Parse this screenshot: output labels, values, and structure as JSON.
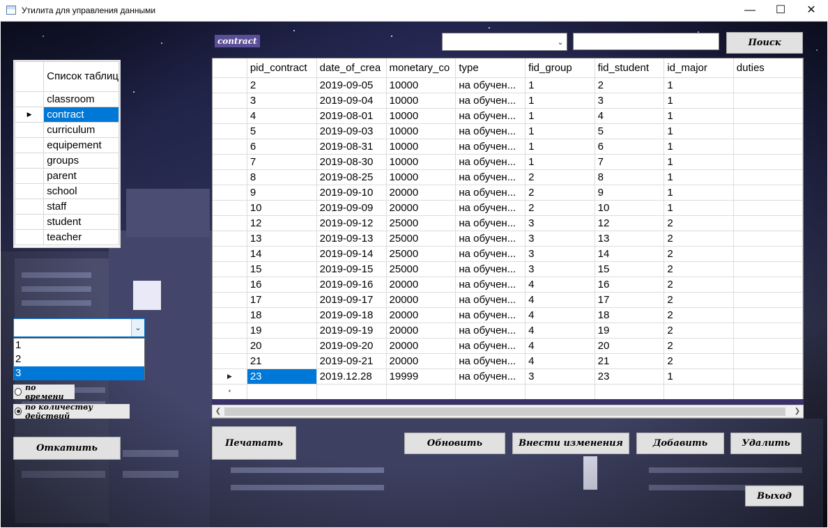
{
  "window": {
    "title": "Утилита для управления данными",
    "minimize_glyph": "—",
    "maximize_glyph": "☐",
    "close_glyph": "✕"
  },
  "current_table_tag": "contract",
  "search": {
    "field_combo_value": "",
    "query_value": "",
    "button_label": "Поиск"
  },
  "tables_list": {
    "header": "Список таблиц",
    "items": [
      "classroom",
      "contract",
      "curriculum",
      "equipement",
      "groups",
      "parent",
      "school",
      "staff",
      "student",
      "teacher"
    ],
    "selected": "contract"
  },
  "grid": {
    "columns": [
      "pid_contract",
      "date_of_crea",
      "monetary_co",
      "type",
      "fid_group",
      "fid_student",
      "id_major",
      "duties"
    ],
    "rows": [
      [
        "2",
        "2019-09-05",
        "10000",
        "на обучен...",
        "1",
        "2",
        "1",
        ""
      ],
      [
        "3",
        "2019-09-04",
        "10000",
        "на обучен...",
        "1",
        "3",
        "1",
        ""
      ],
      [
        "4",
        "2019-08-01",
        "10000",
        "на обучен...",
        "1",
        "4",
        "1",
        ""
      ],
      [
        "5",
        "2019-09-03",
        "10000",
        "на обучен...",
        "1",
        "5",
        "1",
        ""
      ],
      [
        "6",
        "2019-08-31",
        "10000",
        "на обучен...",
        "1",
        "6",
        "1",
        ""
      ],
      [
        "7",
        "2019-08-30",
        "10000",
        "на обучен...",
        "1",
        "7",
        "1",
        ""
      ],
      [
        "8",
        "2019-08-25",
        "10000",
        "на обучен...",
        "2",
        "8",
        "1",
        ""
      ],
      [
        "9",
        "2019-09-10",
        "20000",
        "на обучен...",
        "2",
        "9",
        "1",
        ""
      ],
      [
        "10",
        "2019-09-09",
        "20000",
        "на обучен...",
        "2",
        "10",
        "1",
        ""
      ],
      [
        "12",
        "2019-09-12",
        "25000",
        "на обучен...",
        "3",
        "12",
        "2",
        ""
      ],
      [
        "13",
        "2019-09-13",
        "25000",
        "на обучен...",
        "3",
        "13",
        "2",
        ""
      ],
      [
        "14",
        "2019-09-14",
        "25000",
        "на обучен...",
        "3",
        "14",
        "2",
        ""
      ],
      [
        "15",
        "2019-09-15",
        "25000",
        "на обучен...",
        "3",
        "15",
        "2",
        ""
      ],
      [
        "16",
        "2019-09-16",
        "20000",
        "на обучен...",
        "4",
        "16",
        "2",
        ""
      ],
      [
        "17",
        "2019-09-17",
        "20000",
        "на обучен...",
        "4",
        "17",
        "2",
        ""
      ],
      [
        "18",
        "2019-09-18",
        "20000",
        "на обучен...",
        "4",
        "18",
        "2",
        ""
      ],
      [
        "19",
        "2019-09-19",
        "20000",
        "на обучен...",
        "4",
        "19",
        "2",
        ""
      ],
      [
        "20",
        "2019-09-20",
        "20000",
        "на обучен...",
        "4",
        "20",
        "2",
        ""
      ],
      [
        "21",
        "2019-09-21",
        "20000",
        "на обучен...",
        "4",
        "21",
        "2",
        ""
      ],
      [
        "23",
        "2019.12.28",
        "19999",
        "на обучен...",
        "3",
        "23",
        "1",
        ""
      ]
    ],
    "selected_row_index": 19,
    "new_row_marker": "*",
    "current_row_marker": "▶"
  },
  "history": {
    "combo_value": "",
    "options": [
      "1",
      "2",
      "3"
    ],
    "selected_option": "3",
    "radio_by_time": "по времени",
    "radio_by_count": "по количеству действий",
    "radio_selected": "по количеству действий",
    "rollback_label": "Откатить"
  },
  "actions": {
    "print_label": "Печатать",
    "refresh_label": "Обновить",
    "apply_label": "Внести изменения",
    "add_label": "Добавить",
    "delete_label": "Удалить",
    "exit_label": "Выход"
  }
}
